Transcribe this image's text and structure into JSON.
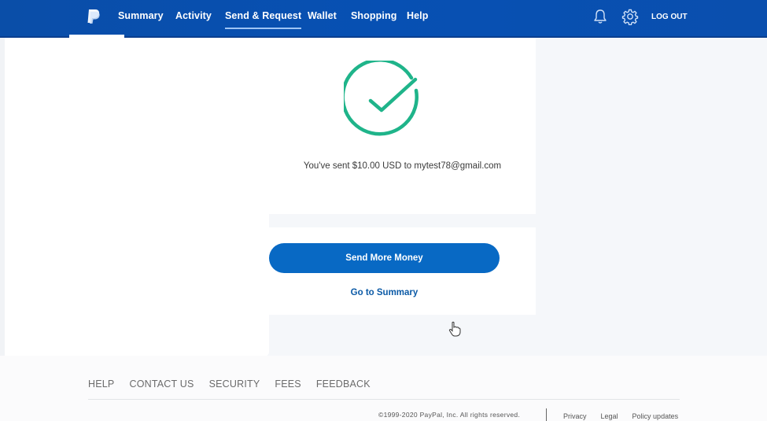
{
  "header": {
    "brand": "PayPal",
    "nav": [
      {
        "label": "Summary",
        "active": false
      },
      {
        "label": "Activity",
        "active": false
      },
      {
        "label": "Send & Request",
        "active": true
      },
      {
        "label": "Wallet",
        "active": false
      },
      {
        "label": "Shopping",
        "active": false
      },
      {
        "label": "Help",
        "active": false
      }
    ],
    "icons": [
      "bell-icon",
      "gear-icon"
    ],
    "logout_label": "LOG OUT"
  },
  "confirmation": {
    "status_icon": "check-circle-icon",
    "message": "You've sent $10.00 USD to mytest78@gmail.com",
    "primary_button": "Send More Money",
    "secondary_link": "Go to Summary"
  },
  "footer": {
    "links": [
      "HELP",
      "CONTACT US",
      "SECURITY",
      "FEES",
      "FEEDBACK"
    ],
    "copyright": "©1999-2020 PayPal, Inc. All rights reserved.",
    "legal_links": [
      "Privacy",
      "Legal",
      "Policy updates"
    ]
  },
  "colors": {
    "header_blue": "#0750b3",
    "button_blue": "#0869c4",
    "link_blue": "#0b5aa6",
    "success_green": "#1fb48a"
  }
}
